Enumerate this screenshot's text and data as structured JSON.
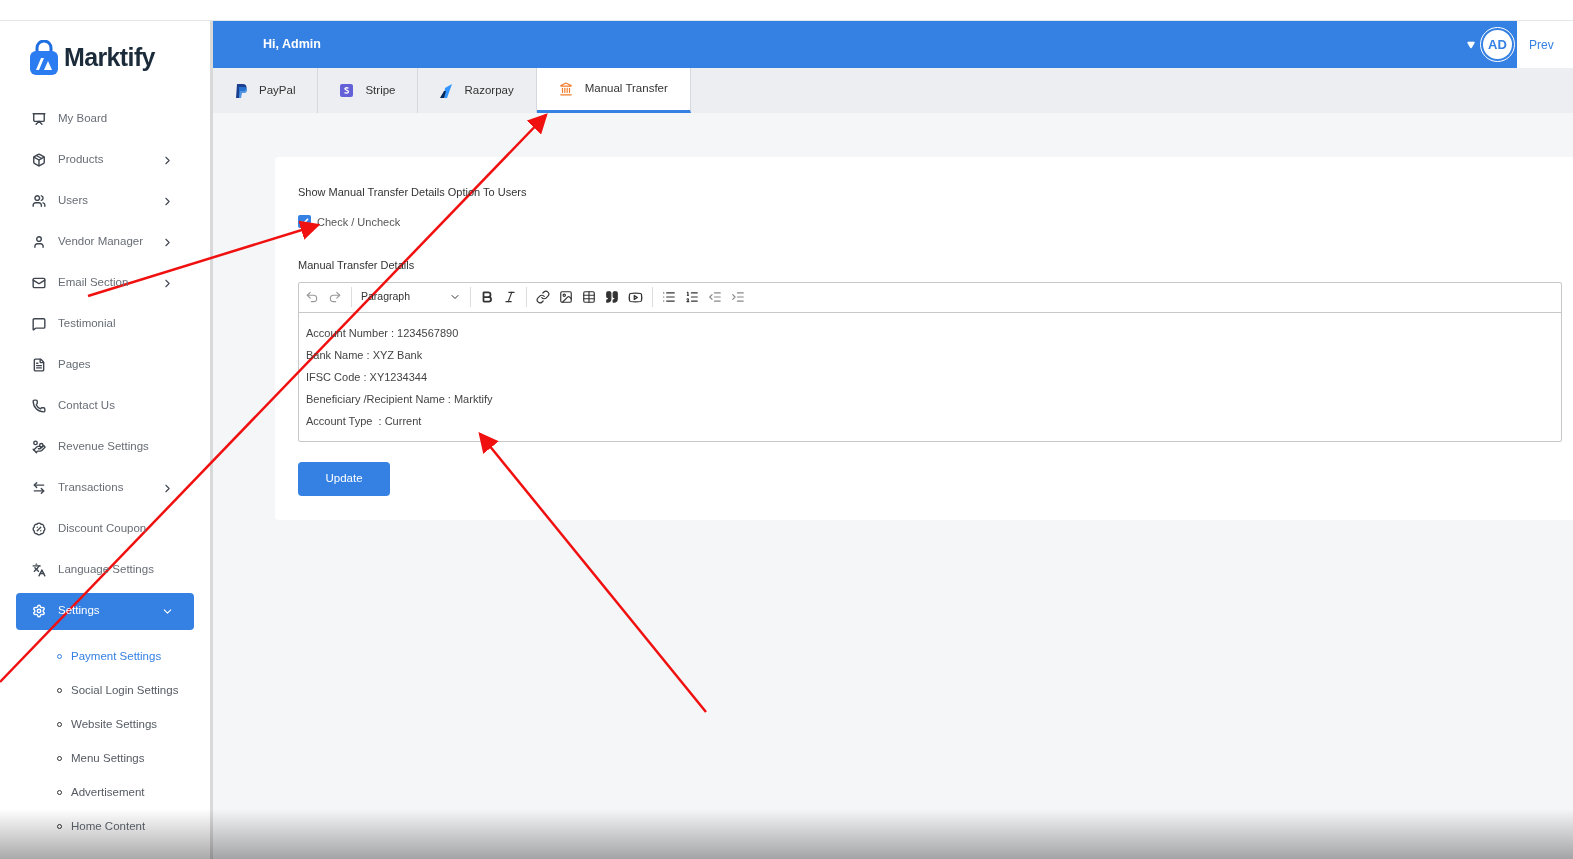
{
  "brand": {
    "name": "Marktify"
  },
  "header": {
    "greeting": "Hi, Admin",
    "avatar": "AD",
    "preview_link": "Prev"
  },
  "sidebar": {
    "items": [
      {
        "label": "My Board",
        "has_submenu": false,
        "selected": false
      },
      {
        "label": "Products",
        "has_submenu": true,
        "selected": false
      },
      {
        "label": "Users",
        "has_submenu": true,
        "selected": false
      },
      {
        "label": "Vendor Manager",
        "has_submenu": true,
        "selected": false
      },
      {
        "label": "Email Section",
        "has_submenu": true,
        "selected": false
      },
      {
        "label": "Testimonial",
        "has_submenu": false,
        "selected": false
      },
      {
        "label": "Pages",
        "has_submenu": false,
        "selected": false
      },
      {
        "label": "Contact Us",
        "has_submenu": false,
        "selected": false
      },
      {
        "label": "Revenue Settings",
        "has_submenu": false,
        "selected": false
      },
      {
        "label": "Transactions",
        "has_submenu": true,
        "selected": false
      },
      {
        "label": "Discount Coupon",
        "has_submenu": false,
        "selected": false
      },
      {
        "label": "Language Settings",
        "has_submenu": false,
        "selected": false
      },
      {
        "label": "Settings",
        "has_submenu": true,
        "selected": true,
        "expanded": true,
        "children": [
          {
            "label": "Payment Settings",
            "selected": true
          },
          {
            "label": "Social Login Settings",
            "selected": false
          },
          {
            "label": "Website Settings",
            "selected": false
          },
          {
            "label": "Menu Settings",
            "selected": false
          },
          {
            "label": "Advertisement",
            "selected": false
          },
          {
            "label": "Home Content",
            "selected": false
          }
        ]
      }
    ]
  },
  "tabs": [
    {
      "label": "PayPal",
      "selected": false
    },
    {
      "label": "Stripe",
      "selected": false
    },
    {
      "label": "Razorpay",
      "selected": false
    },
    {
      "label": "Manual Transfer",
      "selected": true
    }
  ],
  "form": {
    "option_label": "Show Manual Transfer Details Option To Users",
    "checkbox": {
      "label": "Check / Uncheck",
      "checked": true
    },
    "details_label": "Manual Transfer Details",
    "editor": {
      "block_format": "Paragraph",
      "lines": [
        "Account Number : 1234567890",
        "Bank Name : XYZ Bank",
        "IFSC Code : XY1234344",
        "Beneficiary /Recipient Name : Marktify",
        "Account Type  : Current"
      ]
    },
    "submit": "Update"
  }
}
